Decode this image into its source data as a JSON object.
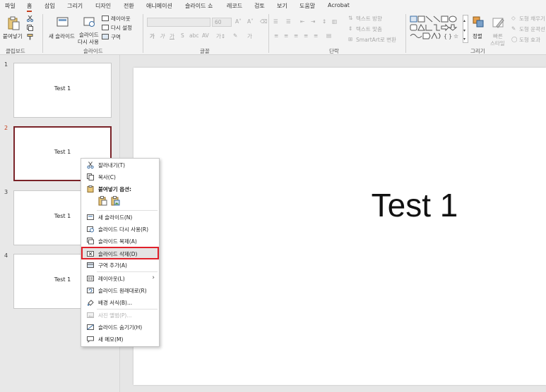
{
  "tabs": [
    "파일",
    "홈",
    "삽입",
    "그리기",
    "디자인",
    "전환",
    "애니메이션",
    "슬라이드 쇼",
    "레코드",
    "검토",
    "보기",
    "도움말",
    "Acrobat"
  ],
  "active_tab": "홈",
  "ribbon": {
    "clipboard": {
      "label": "클립보드",
      "paste": "붙여넣기"
    },
    "slides": {
      "label": "슬라이드",
      "new_slide": "새 슬라이드",
      "reuse_line1": "슬라이드",
      "reuse_line2": "다시 사용",
      "layout": "레이아웃",
      "reset": "다시 설정",
      "section": "구역"
    },
    "font": {
      "label": "글꼴",
      "size": "60"
    },
    "paragraph": {
      "label": "단락",
      "text_direction": "텍스트 방향",
      "align_text": "텍스트 맞춤",
      "smartart": "SmartArt로 변환"
    },
    "drawing": {
      "label": "그리기",
      "arrange": "정렬",
      "quick_styles_1": "빠른",
      "quick_styles_2": "스타일",
      "fill": "도형 채우기",
      "outline": "도형 윤곽선",
      "effects": "도형 효과"
    }
  },
  "thumbnails": [
    {
      "number": "1",
      "text": "Test 1"
    },
    {
      "number": "2",
      "text": "Test 1"
    },
    {
      "number": "3",
      "text": "Test 1"
    },
    {
      "number": "4",
      "text": "Test 1"
    }
  ],
  "selected_thumbnail": "2",
  "slide": {
    "title": "Test 1"
  },
  "context_menu": {
    "items": [
      {
        "label": "잘라내기(T)",
        "icon": "scissors-icon",
        "enabled": true
      },
      {
        "label": "복사(C)",
        "icon": "copy-icon",
        "enabled": true
      },
      {
        "label": "붙여넣기 옵션:",
        "icon": "clipboard-icon",
        "enabled": true,
        "header": true
      },
      {
        "label": "새 슬라이드(N)",
        "icon": "new-slide-icon",
        "enabled": true
      },
      {
        "label": "슬라이드 다시 사용(R)",
        "icon": "reuse-slide-icon",
        "enabled": true
      },
      {
        "label": "슬라이드 복제(A)",
        "icon": "duplicate-slide-icon",
        "enabled": true
      },
      {
        "label": "슬라이드 삭제(D)",
        "icon": "delete-slide-icon",
        "enabled": true,
        "highlighted": true
      },
      {
        "label": "구역 추가(A)",
        "icon": "add-section-icon",
        "enabled": true
      },
      {
        "label": "레이아웃(L)",
        "icon": "layout-icon",
        "enabled": true,
        "submenu": true
      },
      {
        "label": "슬라이드 원래대로(R)",
        "icon": "reset-slide-icon",
        "enabled": true
      },
      {
        "label": "배경 서식(B)...",
        "icon": "format-background-icon",
        "enabled": true
      },
      {
        "label": "사진 앨범(P)...",
        "icon": "photo-album-icon",
        "enabled": false
      },
      {
        "label": "슬라이드 숨기기(H)",
        "icon": "hide-slide-icon",
        "enabled": true
      },
      {
        "label": "새 메모(M)",
        "icon": "new-comment-icon",
        "enabled": true
      }
    ],
    "highlight_color": "#e0202a"
  },
  "colors": {
    "accent": "#c43e1c",
    "selected_border": "#7a2328"
  }
}
